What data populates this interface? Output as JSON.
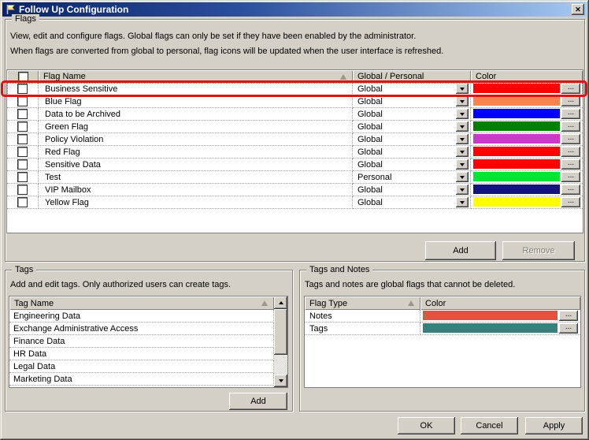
{
  "window": {
    "title": "Follow Up Configuration"
  },
  "icons": {
    "close": "✕"
  },
  "flags": {
    "group_label": "Flags",
    "desc1": "View, edit and configure flags. Global flags can only be set if they have been enabled by the administrator.",
    "desc2": "When flags are converted from global to personal, flag icons will be updated when the user interface is refreshed.",
    "col_name": "Flag Name",
    "col_scope": "Global / Personal",
    "col_color": "Color",
    "rows": [
      {
        "name": "Business Sensitive",
        "scope": "Global",
        "color": "#FF0000",
        "highlighted": true
      },
      {
        "name": "Blue Flag",
        "scope": "Global",
        "color": "#FA8450"
      },
      {
        "name": "Data to be Archived",
        "scope": "Global",
        "color": "#0000FF"
      },
      {
        "name": "Green Flag",
        "scope": "Global",
        "color": "#008000"
      },
      {
        "name": "Policy Violation",
        "scope": "Global",
        "color": "#C73BC7"
      },
      {
        "name": "Red Flag",
        "scope": "Global",
        "color": "#FF0000"
      },
      {
        "name": "Sensitive Data",
        "scope": "Global",
        "color": "#FF0000"
      },
      {
        "name": "Test",
        "scope": "Personal",
        "color": "#00E632"
      },
      {
        "name": "VIP Mailbox",
        "scope": "Global",
        "color": "#131380"
      },
      {
        "name": "Yellow Flag",
        "scope": "Global",
        "color": "#FFFF00"
      }
    ],
    "add_label": "Add",
    "remove_label": "Remove"
  },
  "tags": {
    "group_label": "Tags",
    "desc": "Add and edit tags. Only authorized users can create tags.",
    "col_name": "Tag Name",
    "items": [
      "Engineering Data",
      "Exchange Administrative Access",
      "Finance Data",
      "HR Data",
      "Legal Data",
      "Marketing Data"
    ],
    "add_label": "Add"
  },
  "tags_and_notes": {
    "group_label": "Tags and Notes",
    "desc": "Tags and notes are global flags that cannot be deleted.",
    "col_type": "Flag Type",
    "col_color": "Color",
    "rows": [
      {
        "type": "Notes",
        "color": "#E2543E"
      },
      {
        "type": "Tags",
        "color": "#37807D"
      }
    ]
  },
  "footer": {
    "ok_label": "OK",
    "cancel_label": "Cancel",
    "apply_label": "Apply"
  },
  "misc": {
    "ellipsis": "...",
    "annotation_color": "#DD1310"
  }
}
